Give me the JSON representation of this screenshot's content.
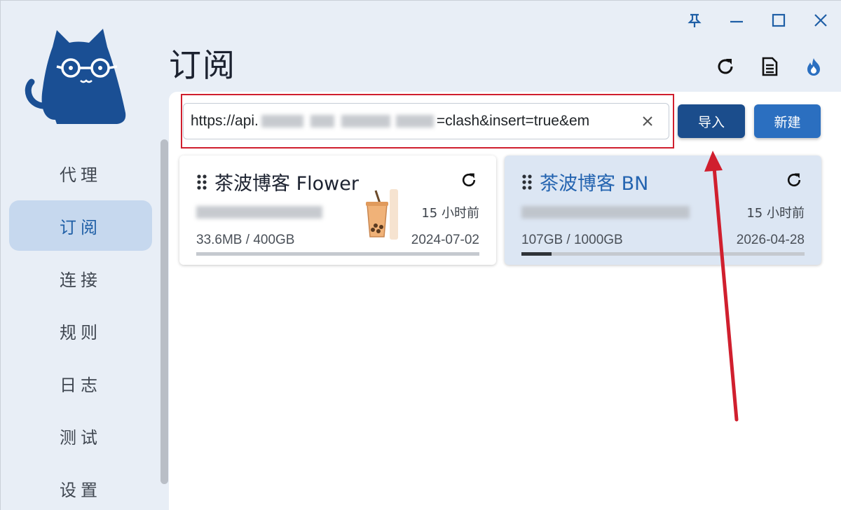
{
  "page": {
    "title": "订阅"
  },
  "window_controls": {
    "pin_icon": "pin-icon",
    "minimize_icon": "minimize-icon",
    "maximize_icon": "maximize-icon",
    "close_icon": "close-icon"
  },
  "toolbar": {
    "refresh_icon": "refresh-icon",
    "document_icon": "document-icon",
    "fire_icon": "fire-icon"
  },
  "sidebar": {
    "items": [
      {
        "label": "代理"
      },
      {
        "label": "订阅"
      },
      {
        "label": "连接"
      },
      {
        "label": "规则"
      },
      {
        "label": "日志"
      },
      {
        "label": "测试"
      },
      {
        "label": "设置"
      }
    ],
    "active_index": 1
  },
  "subscription_url": {
    "value": "https://api.",
    "value_tail": "=clash&insert=true&em"
  },
  "buttons": {
    "import_label": "导入",
    "new_label": "新建"
  },
  "cards": [
    {
      "title": "茶波博客 Flower",
      "updated": "15 小时前",
      "usage": "33.6MB / 400GB",
      "expire": "2024-07-02",
      "progress_fraction": 0.0001,
      "selected": false
    },
    {
      "title": "茶波博客 BN",
      "updated": "15 小时前",
      "usage": "107GB / 1000GB",
      "expire": "2026-04-28",
      "progress_fraction": 0.107,
      "selected": true
    }
  ],
  "colors": {
    "accent": "#2b6fc0",
    "accent_dark": "#1b4d8c",
    "annotation_red": "#d01f2e",
    "sidebar_bg": "#e8eef6",
    "active_nav_bg": "#c6d8ee"
  }
}
